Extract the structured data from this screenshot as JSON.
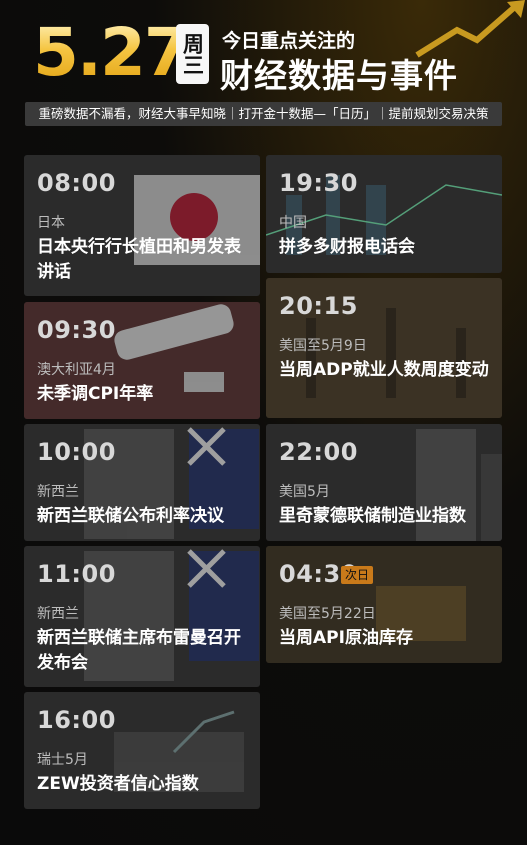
{
  "header": {
    "date": "5.27",
    "weekday": "周三",
    "subtitle": "今日重点关注的",
    "headline": "财经数据与事件",
    "tagline": "重磅数据不漏看，财经大事早知晓｜打开金十数据—「日历」｜提前规划交易决策"
  },
  "events": [
    {
      "time": "08:00",
      "region": "日本",
      "title": "日本央行行长植田和男发表讲话"
    },
    {
      "time": "19:30",
      "region": "中国",
      "title": "拼多多财报电话会"
    },
    {
      "time": "20:15",
      "region": "美国至5月9日",
      "title": "当周ADP就业人数周度变动"
    },
    {
      "time": "09:30",
      "region": "澳大利亚4月",
      "title": "未季调CPI年率"
    },
    {
      "time": "10:00",
      "region": "新西兰",
      "title": "新西兰联储公布利率决议"
    },
    {
      "time": "22:00",
      "region": "美国5月",
      "title": "里奇蒙德联储制造业指数"
    },
    {
      "time": "11:00",
      "region": "新西兰",
      "title": "新西兰联储主席布雷曼召开发布会"
    },
    {
      "time": "04:30",
      "badge": "次日",
      "region": "美国至5月22日",
      "title": "当周API原油库存"
    },
    {
      "time": "16:00",
      "region": "瑞士5月",
      "title": "ZEW投资者信心指数"
    }
  ],
  "colors": {
    "accent": "#f5c542",
    "badge": "#c97a1a",
    "card": "#2b2b2b"
  }
}
